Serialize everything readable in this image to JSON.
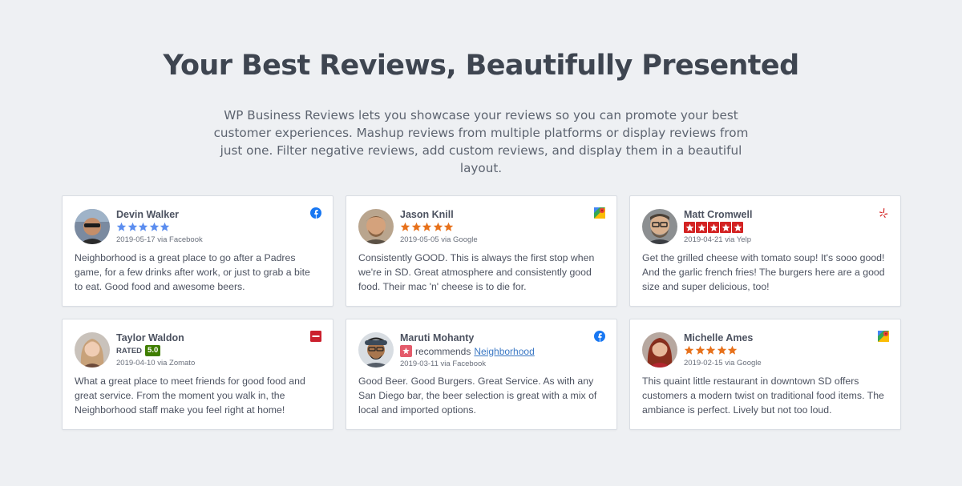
{
  "hero": {
    "title": "Your Best Reviews, Beautifully Presented",
    "description": "WP Business Reviews lets you showcase your reviews so you can promote your best customer experiences. Mashup reviews from multiple platforms or display reviews from just one. Filter negative reviews, add custom reviews, and display them in a beautiful layout."
  },
  "colors": {
    "facebook": "#1877f2",
    "google_star": "#e7711b",
    "facebook_star": "#5b8def",
    "yelp": "#d32323",
    "zomato": "#cb202d",
    "zomato_badge": "#3f7e00",
    "link": "#3b78c4"
  },
  "reviews": [
    {
      "name": "Devin Walker",
      "rating_display": "stars",
      "rating": 5,
      "date_source": "2019-05-17 via Facebook",
      "platform_icon": "facebook-icon",
      "text": "Neighborhood is a great place to go after a Padres game, for a few drinks after work, or just to grab a bite to eat. Good food and awesome beers."
    },
    {
      "name": "Jason Knill",
      "rating_display": "stars",
      "rating": 5,
      "date_source": "2019-05-05 via Google",
      "platform_icon": "google-maps-icon",
      "text": "Consistently GOOD. This is always the first stop when we're in SD. Great atmosphere and consistently good food. Their mac 'n' cheese is to die for."
    },
    {
      "name": "Matt Cromwell",
      "rating_display": "yelp-stars",
      "rating": 5,
      "date_source": "2019-04-21 via Yelp",
      "platform_icon": "yelp-icon",
      "text": "Get the grilled cheese with tomato soup! It's sooo good! And the garlic french fries! The burgers here are a good size and super delicious, too!"
    },
    {
      "name": "Taylor Waldon",
      "rating_display": "rated",
      "rated_label": "RATED",
      "rated_value": "5.0",
      "date_source": "2019-04-10 via Zomato",
      "platform_icon": "zomato-icon",
      "text": "What a great place to meet friends for good food and great service. From the moment you walk in, the Neighborhood staff make you feel right at home!"
    },
    {
      "name": "Maruti Mohanty",
      "rating_display": "recommends",
      "recommends_label": "recommends",
      "recommends_link": "Neighborhood",
      "date_source": "2019-03-11 via Facebook",
      "platform_icon": "facebook-icon",
      "text": "Good Beer. Good Burgers. Great Service. As with any San Diego bar, the beer selection is great with a mix of local and imported options."
    },
    {
      "name": "Michelle Ames",
      "rating_display": "stars",
      "rating": 5,
      "date_source": "2019-02-15 via Google",
      "platform_icon": "google-maps-icon",
      "text": "This quaint little restaurant in downtown SD offers customers a modern twist on traditional food items. The ambiance is perfect. Lively but not too loud."
    }
  ]
}
